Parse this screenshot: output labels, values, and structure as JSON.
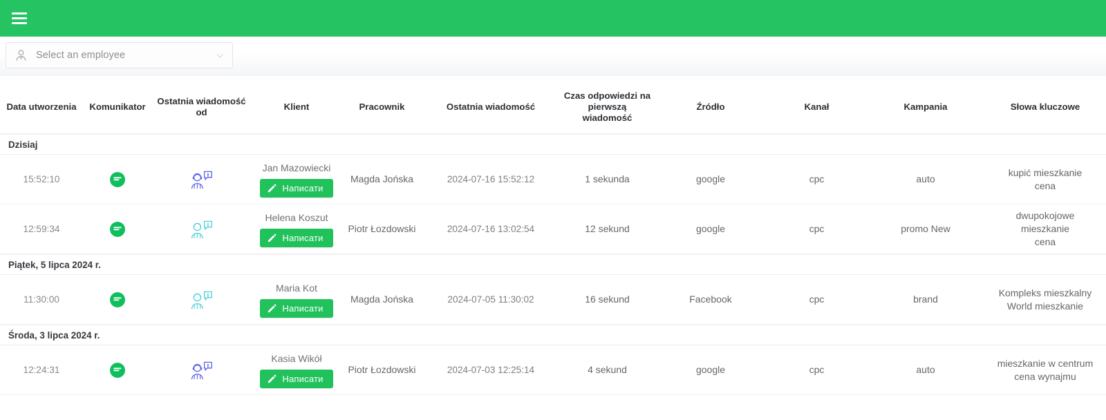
{
  "topbar": {
    "menu_icon": "hamburger-icon"
  },
  "filter": {
    "employee_select": {
      "placeholder": "Select an employee",
      "icon": "employee-avatar-icon",
      "chevron": "chevron-down-icon"
    }
  },
  "table": {
    "columns": [
      "Data utworzenia",
      "Komunikator",
      "Ostatnia wiadomość od",
      "Klient",
      "Pracownik",
      "Ostatnia wiadomość",
      "Czas odpowiedzi na pierwszą wiadomość",
      "Źródło",
      "Kanał",
      "Kampania",
      "Słowa kluczowe"
    ],
    "write_button_label": "Написати",
    "groups": [
      {
        "label": "Dzisiaj",
        "partial_border": false,
        "rows": [
          {
            "created_time": "15:52:10",
            "messenger_icon": "messenger-chat-icon",
            "last_message_from": "operator-icon",
            "client": "Jan Mazowiecki",
            "employee": "Magda Jońska",
            "last_message": "2024-07-16 15:52:12",
            "first_response_time": "1 sekunda",
            "source": "google",
            "channel": "cpc",
            "campaign": "auto",
            "keywords": "kupić mieszkanie\ncena"
          },
          {
            "created_time": "12:59:34",
            "messenger_icon": "messenger-chat-icon",
            "last_message_from": "client-icon",
            "client": "Helena Koszut",
            "employee": "Piotr Łozdowski",
            "last_message": "2024-07-16 13:02:54",
            "first_response_time": "12 sekund",
            "source": "google",
            "channel": "cpc",
            "campaign": "promo New",
            "keywords": "dwupokojowe\nmieszkanie\ncena"
          }
        ]
      },
      {
        "label": "Piątek, 5 lipca 2024 r.",
        "partial_border": false,
        "rows": [
          {
            "created_time": "11:30:00",
            "messenger_icon": "messenger-chat-icon",
            "last_message_from": "client-icon",
            "client": "Maria Kot",
            "employee": "Magda Jońska",
            "last_message": "2024-07-05 11:30:02",
            "first_response_time": "16 sekund",
            "source": "Facebook",
            "channel": "cpc",
            "campaign": "brand",
            "keywords": "Kompleks mieszkalny\nWorld mieszkanie"
          }
        ]
      },
      {
        "label": "Środa, 3 lipca 2024 r.",
        "partial_border": true,
        "rows": [
          {
            "created_time": "12:24:31",
            "messenger_icon": "messenger-chat-icon",
            "last_message_from": "operator-icon",
            "client": "Kasia Wikół",
            "employee": "Piotr Łozdowski",
            "last_message": "2024-07-03 12:25:14",
            "first_response_time": "4 sekund",
            "source": "google",
            "channel": "cpc",
            "campaign": "auto",
            "keywords": "mieszkanie w centrum\ncena wynajmu"
          }
        ]
      }
    ]
  },
  "colors": {
    "brand_green": "#26c363",
    "button_green": "#21c25c",
    "operator_icon_blue": "#5b62e8",
    "client_icon_teal": "#4ecfd8"
  }
}
